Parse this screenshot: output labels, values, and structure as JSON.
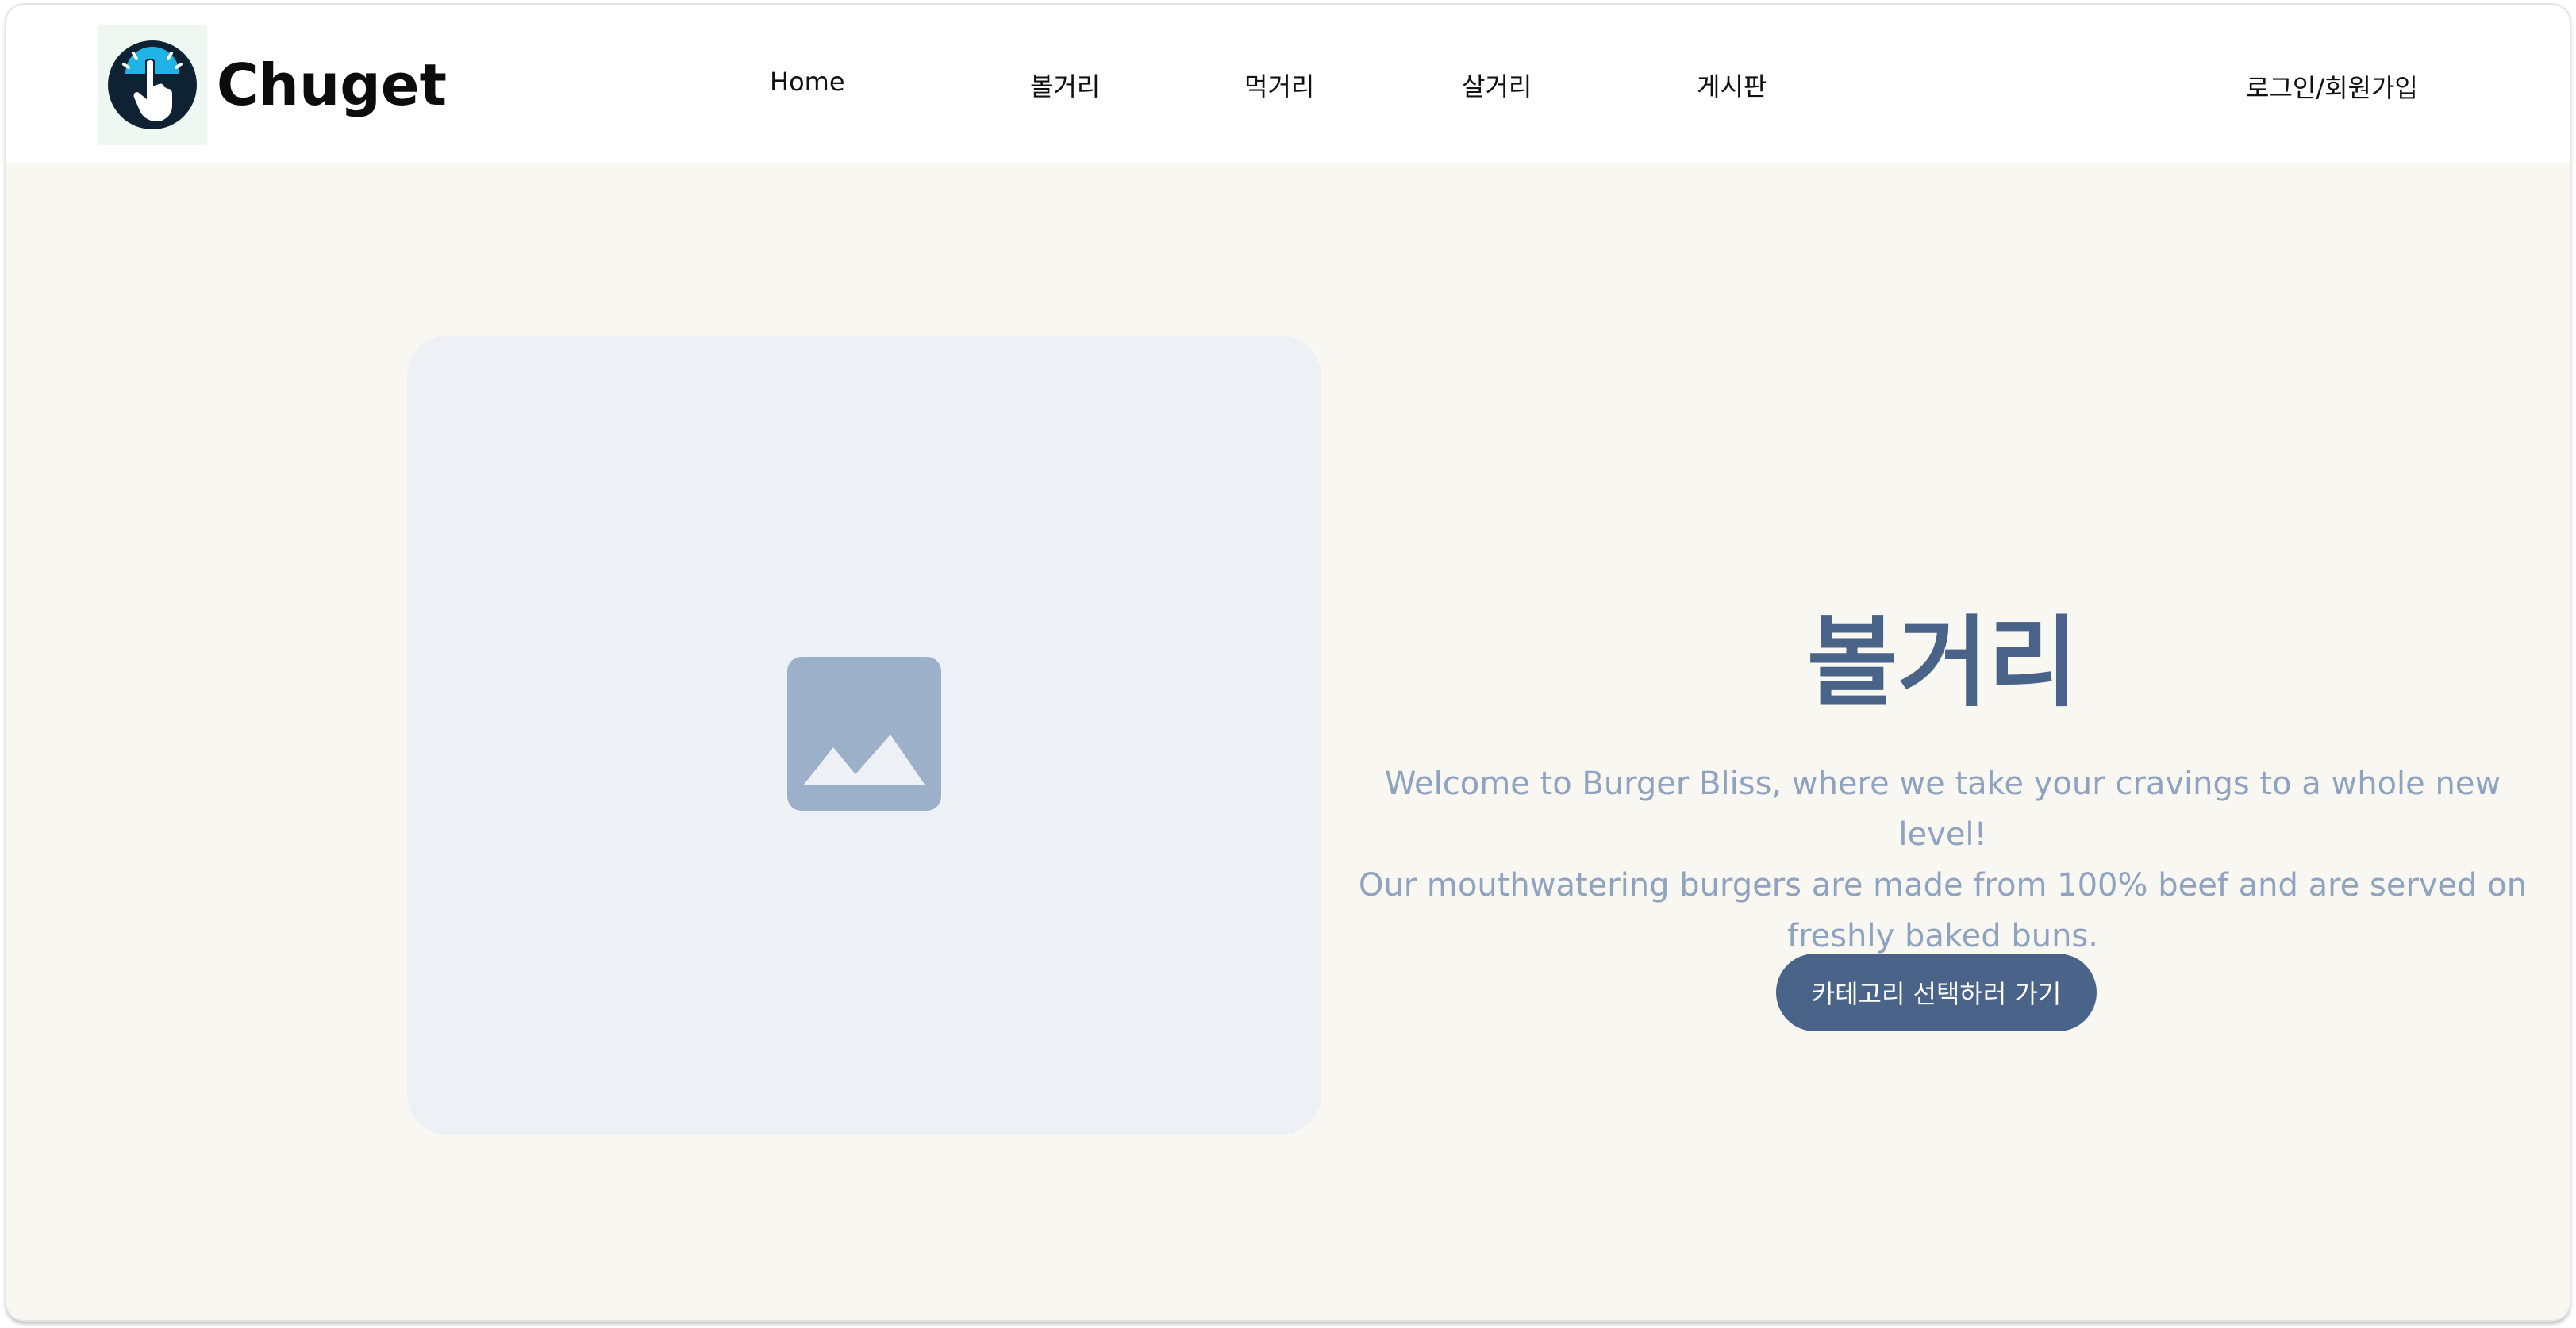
{
  "brand": {
    "name": "Chuget",
    "logo_icon": "pointing-hand-icon"
  },
  "nav": {
    "items": [
      {
        "label": "Home"
      },
      {
        "label": "볼거리"
      },
      {
        "label": "먹거리"
      },
      {
        "label": "살거리"
      },
      {
        "label": "게시판"
      }
    ],
    "login_label": "로그인/회원가입"
  },
  "hero": {
    "image_icon": "image-placeholder-icon",
    "title": "볼거리",
    "description_lines": [
      "Welcome to Burger Bliss, where we take your cravings to a whole new level!",
      "Our mouthwatering burgers are made from 100% beef and are served on",
      "freshly baked buns."
    ],
    "cta_label": "카테고리 선택하러 가기"
  },
  "colors": {
    "page_bg": "#f8f7f2",
    "header_bg": "#ffffff",
    "accent": "#4a6489",
    "muted_text": "#8fa3c0",
    "placeholder_bg": "#edf0f4",
    "placeholder_icon": "#9db0c9",
    "logo_circle": "#0e2233",
    "logo_highlight": "#1fb3e6"
  }
}
